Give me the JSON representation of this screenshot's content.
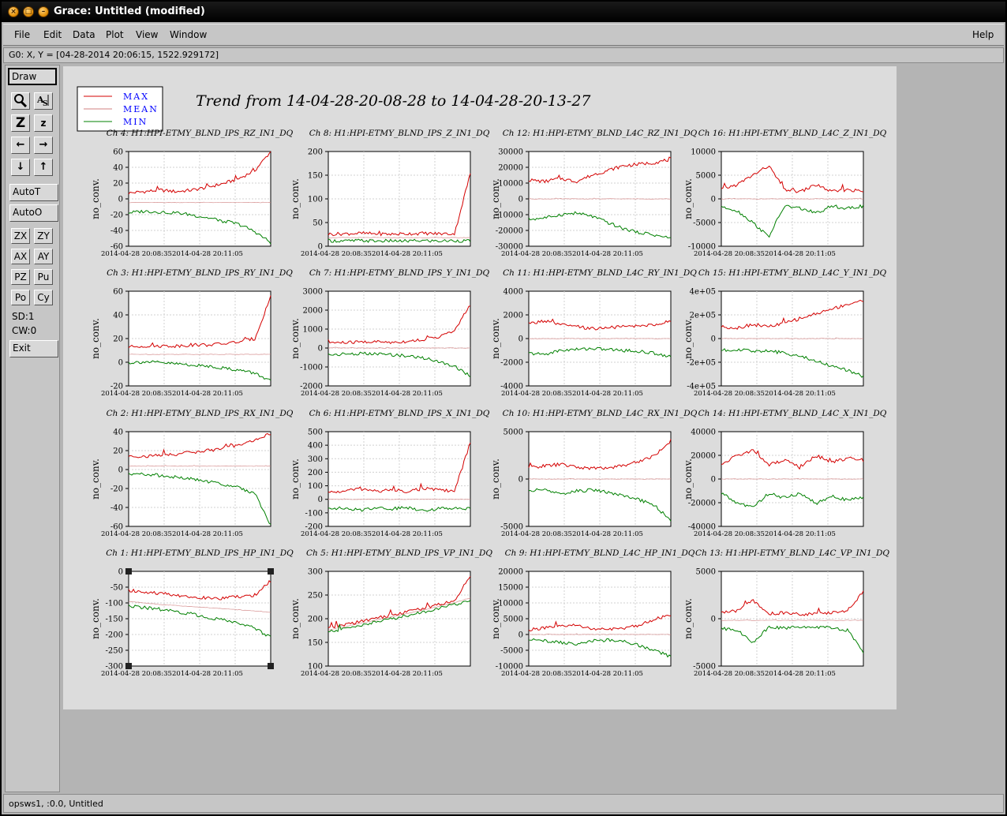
{
  "window": {
    "title": "Grace: Untitled (modified)"
  },
  "menubar": {
    "items": [
      "File",
      "Edit",
      "Data",
      "Plot",
      "View",
      "Window"
    ],
    "help": "Help"
  },
  "locator": "G0: X, Y = [04-28-2014 20:06:15, 1522.929172]",
  "toolbar": {
    "draw": "Draw",
    "autot": "AutoT",
    "autoo": "AutoO",
    "zx": "ZX",
    "zy": "ZY",
    "ax": "AX",
    "ay": "AY",
    "pz": "PZ",
    "pu": "Pu",
    "po": "Po",
    "cy": "Cy",
    "sd": "SD:1",
    "cw": "CW:0",
    "exit": "Exit"
  },
  "statusbar": "opsws1, :0.0, Untitled",
  "colors": {
    "max": "#d40000",
    "mean": "#d08080",
    "min": "#008000",
    "legend_text": "#0000ff"
  },
  "chart_data": {
    "title": "Trend from 14-04-28-20-08-28 to 14-04-28-20-13-27",
    "legend": [
      "MAX",
      "MEAN",
      "MIN"
    ],
    "ylabel": "no_conv.",
    "xticks": [
      "2014-04-28 20:08:35",
      "2014-04-28 20:11:05"
    ],
    "panels": [
      {
        "title": "Ch 4: H1:HPI-ETMY_BLND_IPS_RZ_IN1_DQ",
        "yticks": [
          "60",
          "40",
          "20",
          "0",
          "-20",
          "-40",
          "-60"
        ],
        "ylim": [
          -60,
          70
        ],
        "max": [
          13,
          15,
          17,
          15,
          17,
          21,
          26,
          33,
          44,
          70
        ],
        "mean": [
          0,
          0,
          0,
          0,
          0,
          0,
          0,
          0,
          0,
          0
        ],
        "min": [
          -14,
          -12,
          -13,
          -14,
          -17,
          -21,
          -25,
          -30,
          -40,
          -55
        ]
      },
      {
        "title": "Ch 8: H1:HPI-ETMY_BLND_IPS_Z_IN1_DQ",
        "yticks": [
          "200",
          "150",
          "100",
          "50",
          "0"
        ],
        "ylim": [
          -20,
          200
        ],
        "max": [
          8,
          9,
          10,
          9,
          8,
          9,
          10,
          9,
          9,
          150
        ],
        "mean": [
          0,
          0,
          0,
          0,
          0,
          0,
          0,
          0,
          0,
          0
        ],
        "min": [
          -7,
          -8,
          -7,
          -8,
          -7,
          -8,
          -7,
          -8,
          -7,
          -8
        ]
      },
      {
        "title": "Ch 12: H1:HPI-ETMY_BLND_L4C_RZ_IN1_DQ",
        "yticks": [
          "30000",
          "20000",
          "10000",
          "0",
          "-10000",
          "-20000",
          "-30000"
        ],
        "ylim": [
          -30000,
          30000
        ],
        "max": [
          12000,
          11000,
          13000,
          11000,
          15000,
          18000,
          21000,
          22000,
          23000,
          25000
        ],
        "mean": [
          0,
          0,
          0,
          0,
          0,
          0,
          0,
          0,
          0,
          0
        ],
        "min": [
          -13000,
          -12000,
          -10000,
          -9000,
          -11000,
          -15000,
          -19000,
          -21000,
          -23000,
          -25000
        ]
      },
      {
        "title": "Ch 16: H1:HPI-ETMY_BLND_L4C_Z_IN1_DQ",
        "yticks": [
          "10000",
          "5000",
          "0",
          "-5000",
          "-10000"
        ],
        "ylim": [
          -10000,
          10000
        ],
        "max": [
          2000,
          3000,
          5000,
          7000,
          2000,
          1500,
          3000,
          1500,
          2000,
          1500
        ],
        "mean": [
          0,
          0,
          0,
          0,
          0,
          0,
          0,
          0,
          0,
          0
        ],
        "min": [
          -1500,
          -2500,
          -5000,
          -8000,
          -1500,
          -2000,
          -3000,
          -1500,
          -2000,
          -1500
        ]
      },
      {
        "title": "Ch 3: H1:HPI-ETMY_BLND_IPS_RY_IN1_DQ",
        "yticks": [
          "60",
          "40",
          "20",
          "0",
          "-20"
        ],
        "ylim": [
          -30,
          60
        ],
        "max": [
          7,
          8,
          8,
          8,
          9,
          9,
          10,
          12,
          15,
          55
        ],
        "mean": [
          0,
          0,
          0,
          0,
          0,
          0,
          0,
          0,
          0,
          0
        ],
        "min": [
          -8,
          -7,
          -8,
          -9,
          -10,
          -11,
          -13,
          -15,
          -18,
          -25
        ]
      },
      {
        "title": "Ch 7: H1:HPI-ETMY_BLND_IPS_Y_IN1_DQ",
        "yticks": [
          "3000",
          "2000",
          "1000",
          "0",
          "-1000",
          "-2000"
        ],
        "ylim": [
          -2000,
          3000
        ],
        "max": [
          300,
          280,
          320,
          330,
          300,
          350,
          450,
          600,
          900,
          2300
        ],
        "mean": [
          0,
          0,
          0,
          0,
          0,
          0,
          0,
          0,
          0,
          0
        ],
        "min": [
          -350,
          -320,
          -300,
          -320,
          -350,
          -420,
          -520,
          -700,
          -950,
          -1500
        ]
      },
      {
        "title": "Ch 11: H1:HPI-ETMY_BLND_L4C_RY_IN1_DQ",
        "yticks": [
          "4000",
          "2000",
          "0",
          "-2000",
          "-4000"
        ],
        "ylim": [
          -4800,
          4800
        ],
        "max": [
          1500,
          1800,
          1400,
          1200,
          1000,
          1100,
          1200,
          1300,
          1400,
          1800
        ],
        "mean": [
          0,
          0,
          0,
          0,
          0,
          0,
          0,
          0,
          0,
          0
        ],
        "min": [
          -1500,
          -1600,
          -1200,
          -1100,
          -1000,
          -1100,
          -1200,
          -1300,
          -1500,
          -1800
        ]
      },
      {
        "title": "Ch 15: H1:HPI-ETMY_BLND_L4C_Y_IN1_DQ",
        "yticks": [
          "4e+05",
          "2e+05",
          "0",
          "-2e+05",
          "-4e+05"
        ],
        "ylim": [
          -400000,
          400000
        ],
        "max": [
          100000,
          90000,
          120000,
          100000,
          130000,
          170000,
          210000,
          250000,
          290000,
          320000
        ],
        "mean": [
          0,
          0,
          0,
          0,
          0,
          0,
          0,
          0,
          0,
          0
        ],
        "min": [
          -100000,
          -90000,
          -110000,
          -100000,
          -120000,
          -150000,
          -190000,
          -230000,
          -270000,
          -320000
        ]
      },
      {
        "title": "Ch 2: H1:HPI-ETMY_BLND_IPS_RX_IN1_DQ",
        "yticks": [
          "40",
          "20",
          "0",
          "-20",
          "-40",
          "-60"
        ],
        "ylim": [
          -70,
          40
        ],
        "max": [
          12,
          11,
          13,
          14,
          16,
          18,
          21,
          25,
          30,
          38
        ],
        "mean": [
          0,
          0,
          0,
          0,
          0,
          0,
          0,
          0,
          0,
          0
        ],
        "min": [
          -10,
          -9,
          -11,
          -13,
          -15,
          -18,
          -21,
          -25,
          -32,
          -68
        ]
      },
      {
        "title": "Ch 6: H1:HPI-ETMY_BLND_IPS_X_IN1_DQ",
        "yticks": [
          "500",
          "400",
          "300",
          "200",
          "100",
          "0",
          "-100",
          "-200"
        ],
        "ylim": [
          -200,
          500
        ],
        "max": [
          50,
          60,
          80,
          60,
          70,
          60,
          80,
          70,
          60,
          420
        ],
        "mean": [
          0,
          0,
          0,
          0,
          0,
          0,
          0,
          0,
          0,
          0
        ],
        "min": [
          -60,
          -70,
          -80,
          -60,
          -70,
          -60,
          -80,
          -70,
          -60,
          -70
        ]
      },
      {
        "title": "Ch 10: H1:HPI-ETMY_BLND_L4C_RX_IN1_DQ",
        "yticks": [
          "5000",
          "0",
          "-5000"
        ],
        "ylim": [
          -8000,
          8000
        ],
        "max": [
          2000,
          2200,
          2500,
          2000,
          1800,
          1900,
          2300,
          3000,
          4000,
          6500
        ],
        "mean": [
          0,
          0,
          0,
          0,
          0,
          0,
          0,
          0,
          0,
          0
        ],
        "min": [
          -2000,
          -1800,
          -2500,
          -2000,
          -1800,
          -2200,
          -2800,
          -3500,
          -4500,
          -7000
        ]
      },
      {
        "title": "Ch 14: H1:HPI-ETMY_BLND_L4C_X_IN1_DQ",
        "yticks": [
          "40000",
          "20000",
          "0",
          "-20000",
          "-40000"
        ],
        "ylim": [
          -50000,
          50000
        ],
        "max": [
          15000,
          25000,
          30000,
          15000,
          20000,
          12000,
          25000,
          18000,
          22000,
          20000
        ],
        "mean": [
          0,
          0,
          0,
          0,
          0,
          0,
          0,
          0,
          0,
          0
        ],
        "min": [
          -15000,
          -25000,
          -30000,
          -15000,
          -20000,
          -15000,
          -25000,
          -18000,
          -22000,
          -20000
        ]
      },
      {
        "title": "Ch 1: H1:HPI-ETMY_BLND_IPS_HP_IN1_DQ",
        "yticks": [
          "0",
          "-50",
          "-100",
          "-150",
          "-200",
          "-250",
          "-300"
        ],
        "ylim": [
          -300,
          0
        ],
        "max": [
          -60,
          -65,
          -70,
          -75,
          -80,
          -85,
          -85,
          -80,
          -75,
          -30
        ],
        "mean": [
          -95,
          -100,
          -105,
          -108,
          -112,
          -115,
          -118,
          -122,
          -125,
          -130
        ],
        "min": [
          -110,
          -115,
          -120,
          -128,
          -135,
          -145,
          -155,
          -165,
          -180,
          -210
        ]
      },
      {
        "title": "Ch 5: H1:HPI-ETMY_BLND_IPS_VP_IN1_DQ",
        "yticks": [
          "300",
          "250",
          "200",
          "150",
          "100"
        ],
        "ylim": [
          100,
          300
        ],
        "max": [
          180,
          187,
          194,
          201,
          208,
          215,
          222,
          230,
          238,
          290
        ],
        "mean": [
          176,
          183,
          190,
          197,
          204,
          211,
          218,
          226,
          234,
          244
        ],
        "min": [
          172,
          179,
          186,
          193,
          200,
          207,
          214,
          222,
          230,
          238
        ]
      },
      {
        "title": "Ch 9: H1:HPI-ETMY_BLND_L4C_HP_IN1_DQ",
        "yticks": [
          "20000",
          "15000",
          "10000",
          "5000",
          "0",
          "-5000",
          "-10000"
        ],
        "ylim": [
          -10000,
          20000
        ],
        "max": [
          1500,
          2000,
          2500,
          3000,
          1800,
          1500,
          2000,
          3000,
          5000,
          6000
        ],
        "mean": [
          0,
          0,
          0,
          0,
          0,
          0,
          0,
          0,
          0,
          0
        ],
        "min": [
          -1500,
          -2000,
          -2500,
          -3000,
          -2000,
          -1800,
          -2200,
          -3500,
          -5000,
          -7000
        ]
      },
      {
        "title": "Ch 13: H1:HPI-ETMY_BLND_L4C_VP_IN1_DQ",
        "yticks": [
          "5000",
          "0",
          "-5000"
        ],
        "ylim": [
          -7000,
          7500
        ],
        "max": [
          1200,
          1500,
          3000,
          1000,
          1200,
          900,
          1000,
          1200,
          1500,
          4500
        ],
        "mean": [
          0,
          0,
          0,
          0,
          0,
          0,
          0,
          0,
          0,
          0
        ],
        "min": [
          -1200,
          -1500,
          -3500,
          -1000,
          -1200,
          -900,
          -1000,
          -1200,
          -1500,
          -5000
        ]
      }
    ]
  }
}
